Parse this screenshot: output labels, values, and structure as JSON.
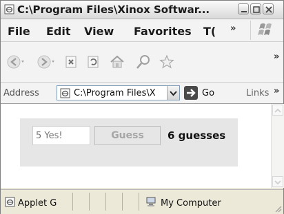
{
  "window": {
    "title": "C:\\Program Files\\Xinox Softwar..."
  },
  "menubar": {
    "items": [
      "File",
      "Edit",
      "View",
      "Favorites",
      "T("
    ],
    "overflow": "»"
  },
  "toolbar": {
    "icons": [
      "back-icon",
      "forward-icon",
      "stop-icon",
      "refresh-icon",
      "home-icon",
      "search-icon",
      "favorites-star-icon"
    ],
    "overflow": "»"
  },
  "addressbar": {
    "label": "Address",
    "value": "C:\\Program Files\\X",
    "go_label": "Go",
    "links_label": "Links",
    "overflow": "»"
  },
  "applet": {
    "input_placeholder": "5 Yes!",
    "button_label": "Guess",
    "count_text": "6 guesses"
  },
  "statusbar": {
    "left_text": "Applet G",
    "zone_text": "My Computer"
  },
  "colors": {
    "applet_bg": "#e6e6e6",
    "disabled_text": "#a6a6a6"
  }
}
